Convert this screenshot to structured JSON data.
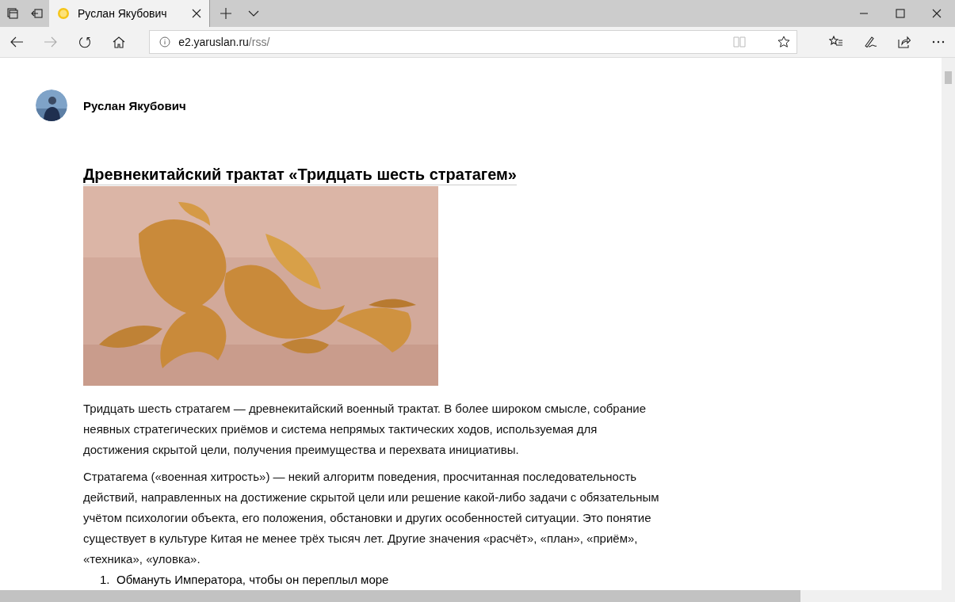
{
  "tabs": [
    {
      "title": "Руслан Якубович",
      "selected": true
    }
  ],
  "address_bar": {
    "host": "e2.yaruslan.ru",
    "path": "/rss/"
  },
  "author": {
    "name": "Руслан Якубович"
  },
  "post": {
    "title": "Древнекитайский трактат «Тридцать шесть стратагем»",
    "paragraphs": [
      "Тридцать шесть стратагем — древнекитайский военный трактат. В более широком смысле, собрание неявных стратегических приёмов и система непрямых тактических ходов, используемая для достижения скрытой цели, получения преимущества и перехвата инициативы.",
      "Стратагема («военная хитрость») — некий алгоритм поведения, просчитанная последовательность действий, направленных на достижение скрытой цели или решение какой-либо задачи с обязательным учётом психологии объекта, его положения, обстановки и других особенностей ситуации. Это понятие существует в культуре Китая не менее трёх тысяч лет. Другие значения «расчёт», «план», «приём», «техника», «уловка»."
    ],
    "list": [
      {
        "number": "1.",
        "text": "Обмануть Императора, чтобы он переплыл море"
      }
    ]
  }
}
